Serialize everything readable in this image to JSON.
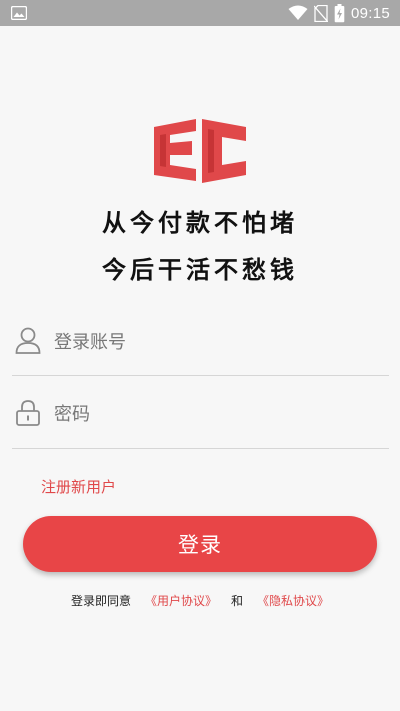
{
  "status_bar": {
    "time": "09:15",
    "icons": [
      "image-icon",
      "wifi-icon",
      "no-sim-icon",
      "battery-charging-icon"
    ]
  },
  "brand": {
    "logo_icon": "ec-logo-icon",
    "slogan_line1": "从今付款不怕堵",
    "slogan_line2": "今后干活不愁钱",
    "accent_color": "#e84547"
  },
  "form": {
    "account": {
      "placeholder": "登录账号",
      "value": "",
      "icon": "user-icon"
    },
    "password": {
      "placeholder": "密码",
      "value": "",
      "icon": "lock-icon"
    },
    "register_label": "注册新用户",
    "login_label": "登录"
  },
  "agreement": {
    "prefix": "登录即同意",
    "user_agreement": "《用户协议》",
    "conjunction": "和",
    "privacy_policy": "《隐私协议》"
  }
}
